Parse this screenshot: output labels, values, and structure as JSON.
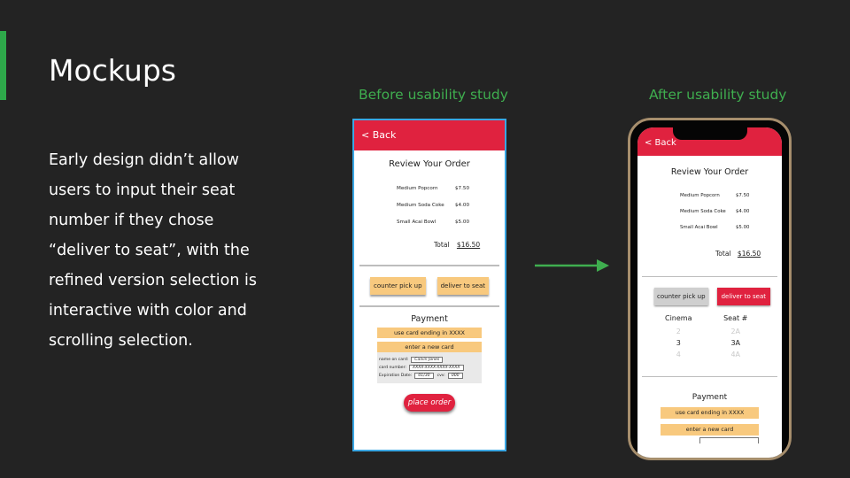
{
  "slide": {
    "title": "Mockups",
    "body": "Early design didn’t allow users to input their seat number if they chose “deliver to seat”, with the refined version selection is interactive with color and scrolling selection.",
    "label_before": "Before usability study",
    "label_after": "After usability study",
    "accent_color": "#2ea84a"
  },
  "before": {
    "back": "< Back",
    "review_title": "Review Your Order",
    "items": [
      {
        "name": "Medium Popcorn",
        "price": "$7.50"
      },
      {
        "name": "Medium Soda Coke",
        "price": "$4.00"
      },
      {
        "name": "Small Acai Bowl",
        "price": "$5.00"
      }
    ],
    "total_label": "Total",
    "total_value": "$16.50",
    "option_pickup": "counter pick up",
    "option_deliver": "deliver to seat",
    "payment_title": "Payment",
    "use_card": "use card ending in XXXX",
    "new_card": "enter a new card",
    "name_label": "name on card:",
    "name_value": "Calvin Jones",
    "number_label": "card number:",
    "number_value": "XXXX-XXXX-XXXX-XXXX",
    "exp_label": "Expiration Date:",
    "exp_value": "01/30",
    "cvv_label": "cvv:",
    "cvv_value": "000",
    "place_order": "place order"
  },
  "after": {
    "back": "< Back",
    "review_title": "Review Your Order",
    "items": [
      {
        "name": "Medium Popcorn",
        "price": "$7.50"
      },
      {
        "name": "Medium Soda Coke",
        "price": "$4.00"
      },
      {
        "name": "Small Acai Bowl",
        "price": "$5.00"
      }
    ],
    "total_label": "Total",
    "total_value": "$16.50",
    "option_pickup": "counter pick up",
    "option_deliver": "deliver to seat",
    "picker": {
      "cinema_header": "Cinema",
      "seat_header": "Seat #",
      "cinema_values": [
        "2",
        "3",
        "4"
      ],
      "seat_values": [
        "2A",
        "3A",
        "4A"
      ]
    },
    "payment_title": "Payment",
    "use_card": "use card ending in XXXX",
    "new_card": "enter a new card"
  }
}
